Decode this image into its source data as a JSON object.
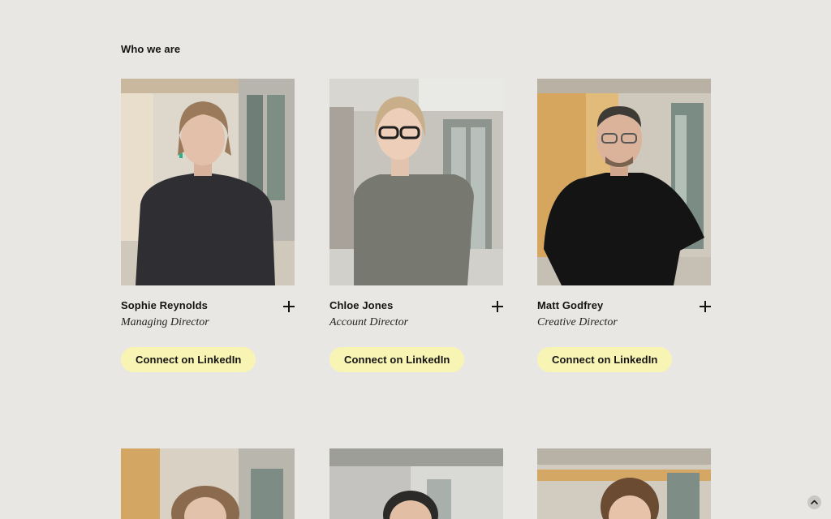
{
  "section": {
    "label": "Who we are"
  },
  "team": [
    {
      "name": "Sophie Reynolds",
      "role": "Managing Director",
      "linkedin_label": "Connect on LinkedIn",
      "expand_icon": "plus-icon"
    },
    {
      "name": "Chloe Jones",
      "role": "Account Director",
      "linkedin_label": "Connect on LinkedIn",
      "expand_icon": "plus-icon"
    },
    {
      "name": "Matt Godfrey",
      "role": "Creative Director",
      "linkedin_label": "Connect on LinkedIn",
      "expand_icon": "plus-icon"
    }
  ],
  "scroll_top": {
    "icon": "chevron-up-icon"
  },
  "colors": {
    "page_background": "#E9E7E3",
    "button_background": "#F8F5B4",
    "text": "#141414"
  }
}
